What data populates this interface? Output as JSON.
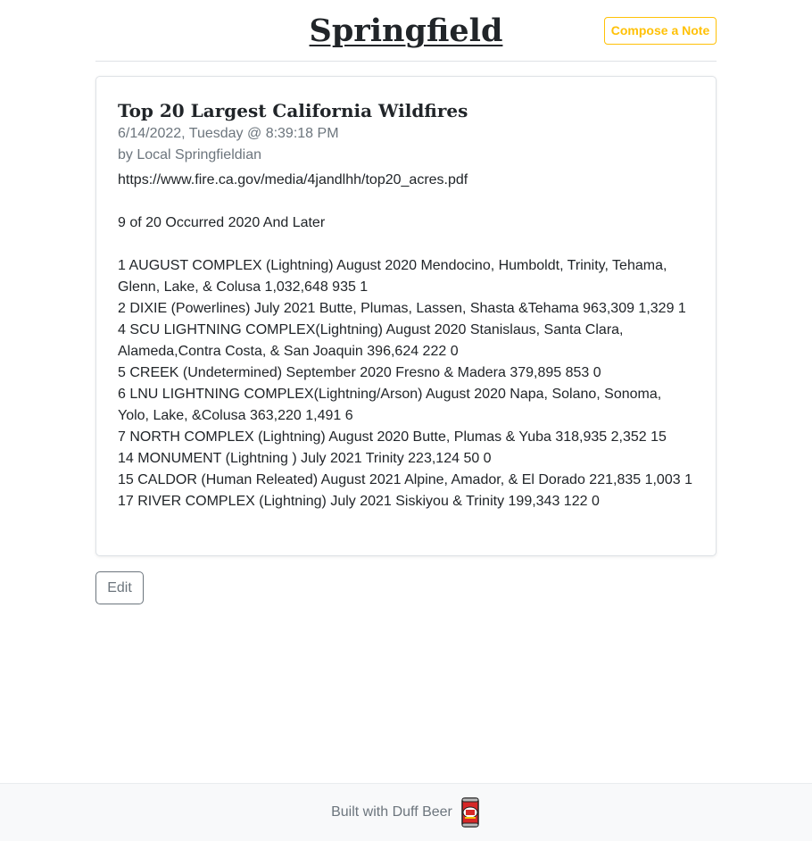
{
  "header": {
    "site_title": "Springfield",
    "compose_label": "Compose a Note",
    "accent_color": "#ffc107"
  },
  "note": {
    "title": "Top 20 Largest California Wildfires",
    "timestamp": "6/14/2022, Tuesday @ 8:39:18 PM",
    "author": "by Local Springfieldian",
    "body_lines": [
      "https://www.fire.ca.gov/media/4jandlhh/top20_acres.pdf",
      "",
      "9 of 20 Occurred 2020 And Later",
      "",
      "1 AUGUST COMPLEX (Lightning) August 2020 Mendocino, Humboldt, Trinity, Tehama, Glenn, Lake, & Colusa 1,032,648 935 1",
      "2 DIXIE (Powerlines) July 2021 Butte, Plumas, Lassen, Shasta &Tehama 963,309 1,329 1",
      "4 SCU LIGHTNING COMPLEX(Lightning) August 2020 Stanislaus, Santa Clara, Alameda,Contra Costa, & San Joaquin 396,624 222 0",
      "5 CREEK (Undetermined) September 2020 Fresno & Madera 379,895 853 0",
      "6 LNU LIGHTNING COMPLEX(Lightning/Arson) August 2020 Napa, Solano, Sonoma, Yolo, Lake, &Colusa 363,220 1,491 6",
      "7 NORTH COMPLEX (Lightning) August 2020 Butte, Plumas & Yuba 318,935 2,352 15",
      "14 MONUMENT (Lightning ) July 2021 Trinity 223,124 50 0",
      "15 CALDOR (Human Releated) August 2021 Alpine, Amador, & El Dorado 221,835 1,003 1",
      "17 RIVER COMPLEX (Lightning) July 2021 Siskiyou & Trinity 199,343 122 0"
    ]
  },
  "actions": {
    "edit_label": "Edit"
  },
  "footer": {
    "text": "Built with Duff Beer",
    "icon": "duff-beer-can-icon"
  }
}
